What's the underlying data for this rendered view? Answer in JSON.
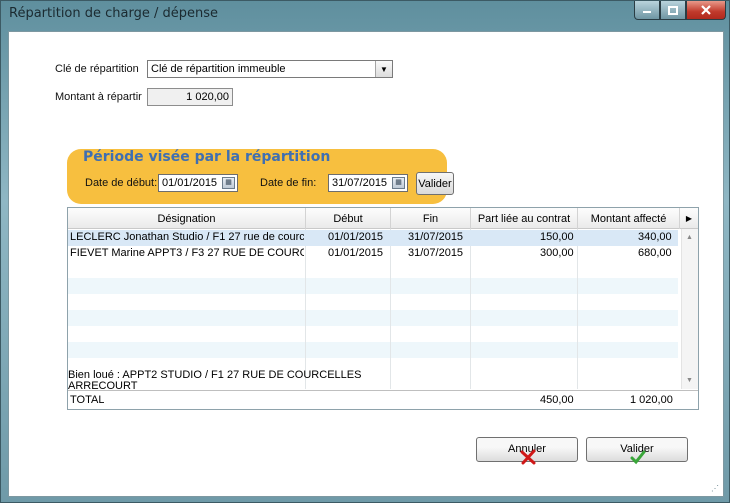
{
  "window": {
    "title": "Répartition de charge / dépense"
  },
  "form": {
    "cle_label": "Clé de répartition",
    "cle_value": "Clé de répartition immeuble",
    "montant_label": "Montant à répartir",
    "montant_value": "1 020,00"
  },
  "period": {
    "title": "Période visée par la répartition",
    "debut_label": "Date de début:",
    "debut_value": "01/01/2015",
    "fin_label": "Date de fin:",
    "fin_value": "31/07/2015",
    "valider_label": "Valider"
  },
  "grid": {
    "columns": [
      "Désignation",
      "Début",
      "Fin",
      "Part liée au contrat",
      "Montant affecté"
    ],
    "rows": [
      {
        "designation": "LECLERC Jonathan Studio / F1 27 rue de courc",
        "debut": "01/01/2015",
        "fin": "31/07/2015",
        "part": "150,00",
        "montant": "340,00"
      },
      {
        "designation": "FIEVET Marine APPT3 / F3 27 RUE DE COURCEL",
        "debut": "01/01/2015",
        "fin": "31/07/2015",
        "part": "300,00",
        "montant": "680,00"
      }
    ],
    "footnote": "Bien loué : APPT2 STUDIO / F1 27 RUE DE COURCELLES ARRECOURT",
    "total_label": "TOTAL",
    "total_part": "450,00",
    "total_montant": "1 020,00"
  },
  "buttons": {
    "annuler": "Annuler",
    "valider": "Valider"
  },
  "colors": {
    "period_bg": "#f7bf3f",
    "period_title": "#3f6fb2",
    "selected_row": "#d9e8f6"
  }
}
